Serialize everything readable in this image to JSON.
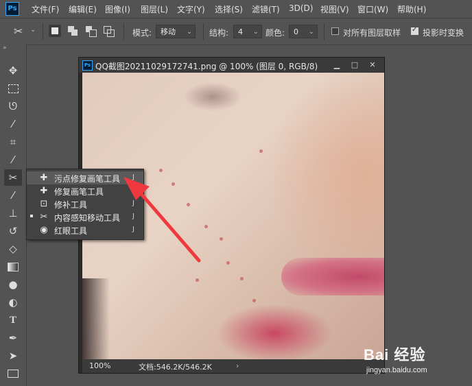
{
  "app": {
    "logo": "Ps"
  },
  "menubar": {
    "items": [
      "文件(F)",
      "编辑(E)",
      "图像(I)",
      "图层(L)",
      "文字(Y)",
      "选择(S)",
      "滤镜(T)",
      "3D(D)",
      "视图(V)",
      "窗口(W)",
      "帮助(H)"
    ]
  },
  "options": {
    "mode_label": "模式:",
    "mode_value": "移动",
    "structure_label": "结构:",
    "structure_value": "4",
    "color_label": "颜色:",
    "color_value": "0",
    "sample_all_label": "对所有图层取样",
    "sample_all_checked": false,
    "transform_drop_label": "投影时变换",
    "transform_drop_checked": true
  },
  "document": {
    "title": "QQ截图20211029172741.png @ 100% (图层 0, RGB/8)",
    "zoom": "100%",
    "doc_info": "文档:546.2K/546.2K",
    "status_arrow": "›"
  },
  "flyout": {
    "items": [
      {
        "label": "污点修复画笔工具",
        "shortcut": "J",
        "icon": "spot-healing-brush-icon",
        "highlighted": true,
        "current": false
      },
      {
        "label": "修复画笔工具",
        "shortcut": "J",
        "icon": "healing-brush-icon",
        "highlighted": false,
        "current": false
      },
      {
        "label": "修补工具",
        "shortcut": "J",
        "icon": "patch-icon",
        "highlighted": false,
        "current": false
      },
      {
        "label": "内容感知移动工具",
        "shortcut": "J",
        "icon": "content-aware-move-icon",
        "highlighted": false,
        "current": true
      },
      {
        "label": "红眼工具",
        "shortcut": "J",
        "icon": "red-eye-icon",
        "highlighted": false,
        "current": false
      }
    ]
  },
  "annotation": {
    "arrow_color": "#f0393f"
  },
  "watermark": {
    "brand": "Bai 经验",
    "url": "jingyan.baidu.com"
  },
  "colors": {
    "ui_bg": "#535353",
    "accent": "#31a8ff"
  }
}
